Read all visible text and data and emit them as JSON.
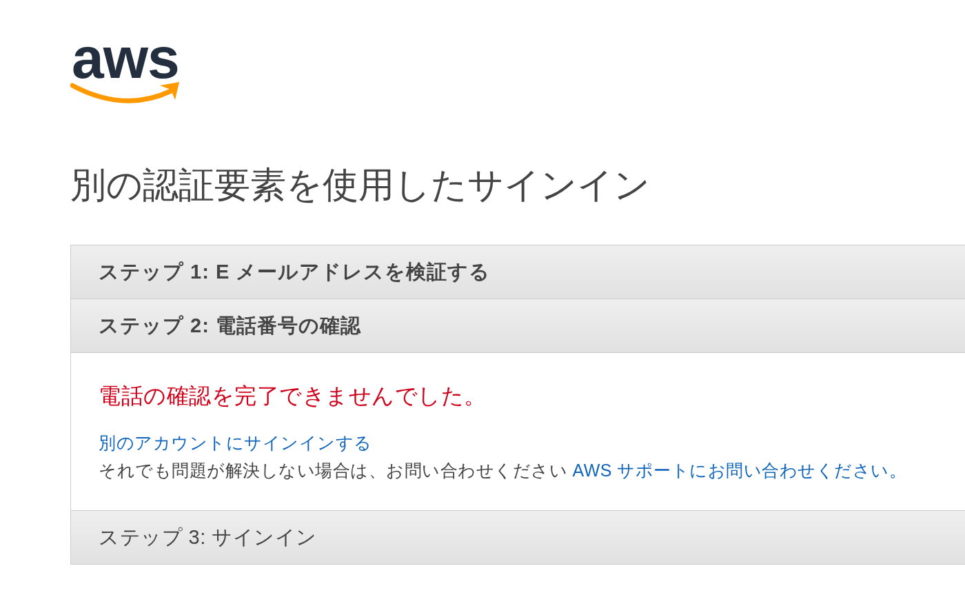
{
  "logo": {
    "text": "aws"
  },
  "title": "別の認証要素を使用したサインイン",
  "steps": [
    {
      "label": "ステップ 1: E メールアドレスを検証する",
      "reached": true
    },
    {
      "label": "ステップ 2: 電話番号の確認",
      "reached": true,
      "error": "電話の確認を完了できませんでした。",
      "link": "別のアカウントにサインインする",
      "help": {
        "text": "それでも問題が解決しない場合は、お問い合わせください",
        "link": "AWS サポートにお問い合わせください。"
      }
    },
    {
      "label": "ステップ 3: サインイン",
      "reached": false
    }
  ]
}
